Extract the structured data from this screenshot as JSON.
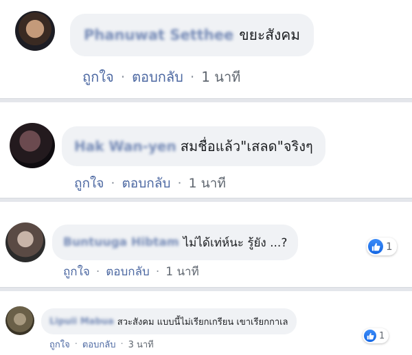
{
  "comments": [
    {
      "author": "Phanuwat Setthee",
      "text": "ขยะสังคม",
      "like_label": "ถูกใจ",
      "reply_label": "ตอบกลับ",
      "separator": "·",
      "time": "1 นาที",
      "avatar_colors": [
        "#3a2a22",
        "#c49a7a",
        "#1d1d24"
      ]
    },
    {
      "author": "Hak Wan-yen",
      "text": "สมชื่อแล้ว\"เสลด\"จริงๆ",
      "like_label": "ถูกใจ",
      "reply_label": "ตอบกลับ",
      "separator": "·",
      "time": "1 นาที",
      "avatar_colors": [
        "#231a1e",
        "#6b4a4f",
        "#0f0c10"
      ]
    },
    {
      "author": "Buntuuga Hibtam",
      "text": "ไม่ได้เท่ห์นะ รู้ยัง ...?",
      "like_label": "ถูกใจ",
      "reply_label": "ตอบกลับ",
      "separator": "·",
      "time": "1 นาที",
      "reaction_count": "1",
      "avatar_colors": [
        "#5a4a44",
        "#c8b4a8",
        "#2b2b2b"
      ]
    },
    {
      "author": "Lipuii Mabua",
      "text": "สวะสังคม แบบนี้ไม่เรียกเกรียน เขาเรียกกาเล",
      "like_label": "ถูกใจ",
      "reply_label": "ตอบกลับ",
      "separator": "·",
      "time": "3 นาที",
      "reaction_count": "1",
      "avatar_colors": [
        "#6a6048",
        "#a89a80",
        "#3a3426"
      ]
    }
  ],
  "icons": {
    "reaction": "like-thumb-icon"
  },
  "colors": {
    "link": "#4b67a1",
    "bubble": "#f0f2f5",
    "like": "#1877f2"
  }
}
